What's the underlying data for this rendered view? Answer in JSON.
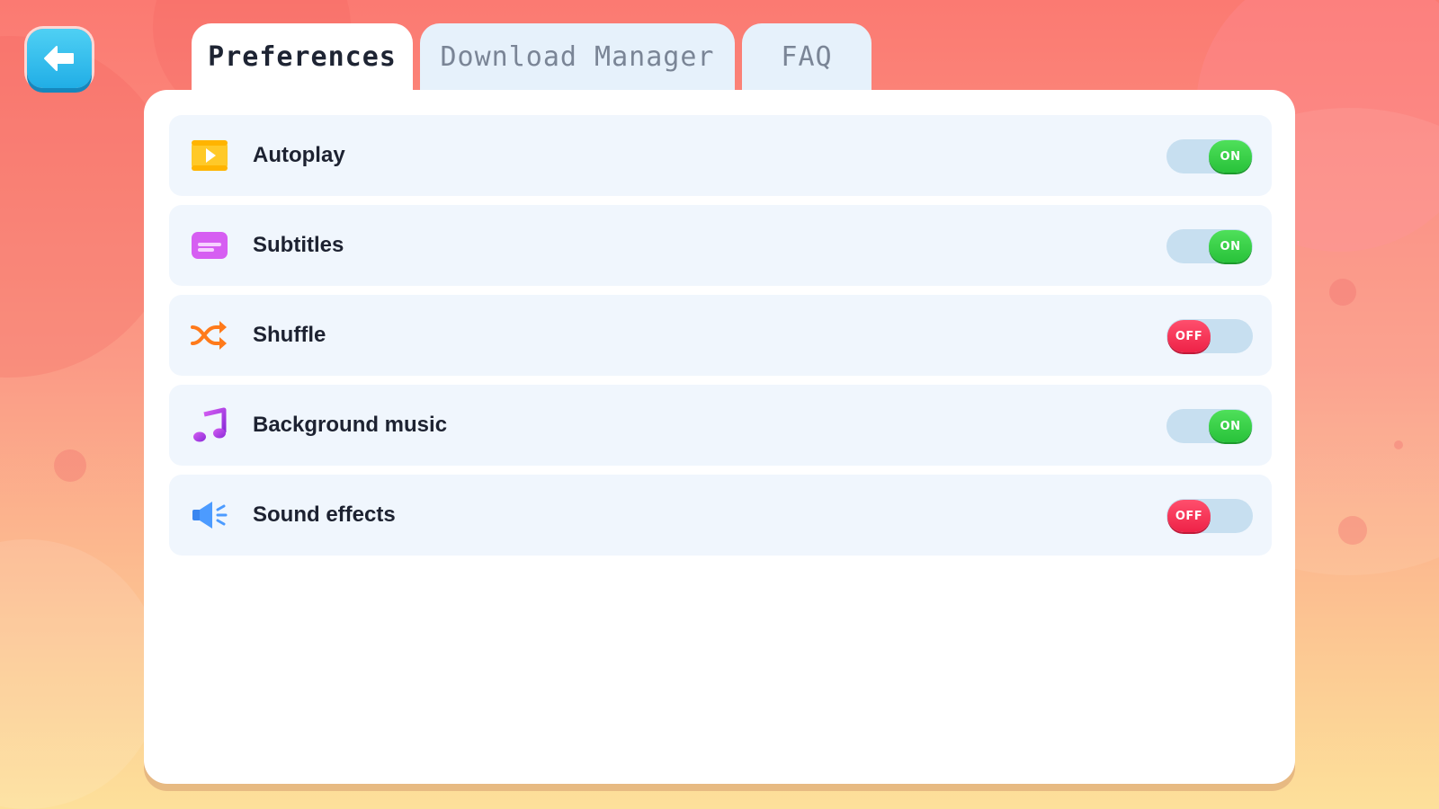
{
  "back_button": {
    "icon": "arrow-left-icon"
  },
  "tabs": [
    {
      "label": "Preferences",
      "active": true
    },
    {
      "label": "Download Manager",
      "active": false
    },
    {
      "label": "FAQ",
      "active": false
    }
  ],
  "settings": [
    {
      "label": "Autoplay",
      "icon": "play-video-icon",
      "state": "ON",
      "on": true
    },
    {
      "label": "Subtitles",
      "icon": "subtitles-icon",
      "state": "ON",
      "on": true
    },
    {
      "label": "Shuffle",
      "icon": "shuffle-icon",
      "state": "OFF",
      "on": false
    },
    {
      "label": "Background music",
      "icon": "music-note-icon",
      "state": "ON",
      "on": true
    },
    {
      "label": "Sound effects",
      "icon": "speaker-icon",
      "state": "OFF",
      "on": false
    }
  ],
  "colors": {
    "toggle_on": "#2fc740",
    "toggle_off": "#f0294e",
    "back_button": "#2bb6ea",
    "active_tab": "#ffffff",
    "inactive_tab": "#e6f1fb"
  }
}
